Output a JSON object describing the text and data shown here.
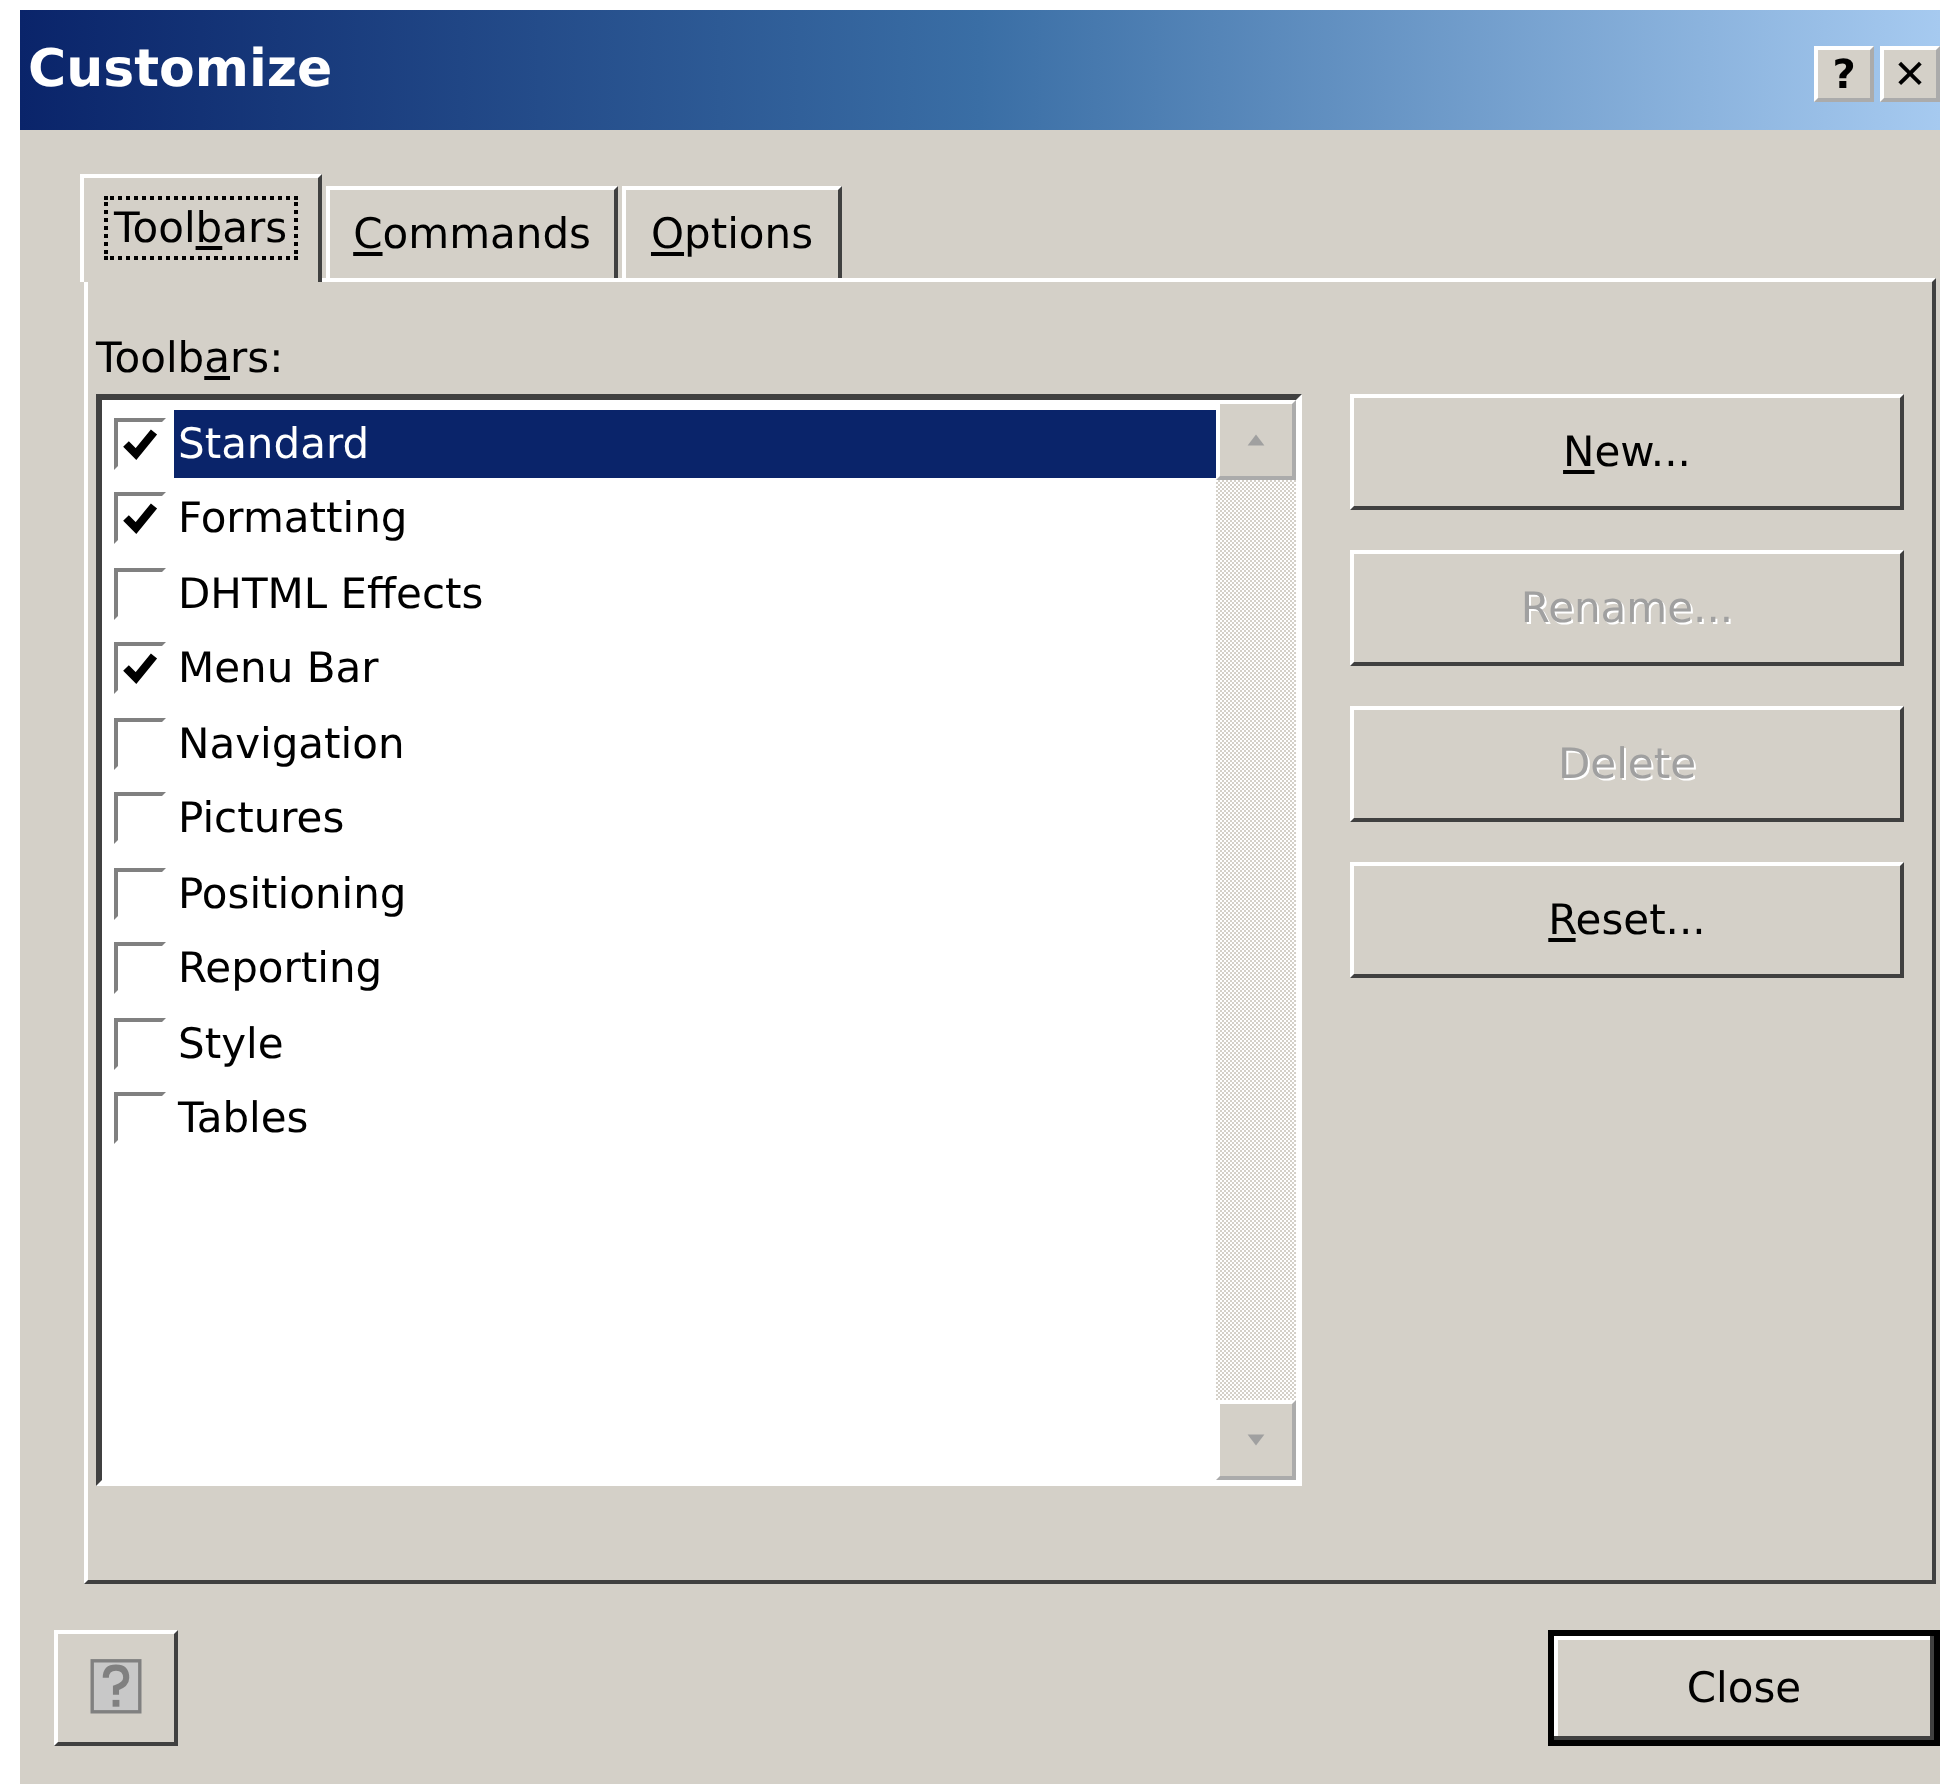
{
  "window": {
    "title": "Customize",
    "title_buttons": [
      "?",
      "✕"
    ]
  },
  "tabs": [
    {
      "label": [
        {
          "text": "Tool",
          "underline": false
        },
        {
          "text": "b",
          "underline": true
        },
        {
          "text": "ars",
          "underline": false
        }
      ],
      "selected": true
    },
    {
      "label": [
        {
          "text": "C",
          "underline": true
        },
        {
          "text": "ommands",
          "underline": false
        }
      ],
      "selected": false
    },
    {
      "label": [
        {
          "text": "O",
          "underline": true
        },
        {
          "text": "ptions",
          "underline": false
        }
      ],
      "selected": false
    }
  ],
  "toolbars_label": [
    {
      "text": "Toolb",
      "underline": false
    },
    {
      "text": "a",
      "underline": true
    },
    {
      "text": "rs:",
      "underline": false
    }
  ],
  "toolbars": [
    {
      "name": "Standard",
      "checked": true,
      "selected": true
    },
    {
      "name": "Formatting",
      "checked": true,
      "selected": false
    },
    {
      "name": "DHTML Effects",
      "checked": false,
      "selected": false
    },
    {
      "name": "Menu Bar",
      "checked": true,
      "selected": false
    },
    {
      "name": "Navigation",
      "checked": false,
      "selected": false
    },
    {
      "name": "Pictures",
      "checked": false,
      "selected": false
    },
    {
      "name": "Positioning",
      "checked": false,
      "selected": false
    },
    {
      "name": "Reporting",
      "checked": false,
      "selected": false
    },
    {
      "name": "Style",
      "checked": false,
      "selected": false
    },
    {
      "name": "Tables",
      "checked": false,
      "selected": false
    }
  ],
  "buttons": [
    {
      "label": [
        {
          "text": "N",
          "underline": true
        },
        {
          "text": "ew...",
          "underline": false
        }
      ],
      "disabled": false
    },
    {
      "label": [
        {
          "text": "Rename...",
          "underline": false
        }
      ],
      "disabled": true
    },
    {
      "label": [
        {
          "text": "Delete",
          "underline": false
        }
      ],
      "disabled": true
    },
    {
      "label": [
        {
          "text": "R",
          "underline": true
        },
        {
          "text": "eset...",
          "underline": false
        }
      ],
      "disabled": false
    }
  ],
  "close_button": "Close"
}
